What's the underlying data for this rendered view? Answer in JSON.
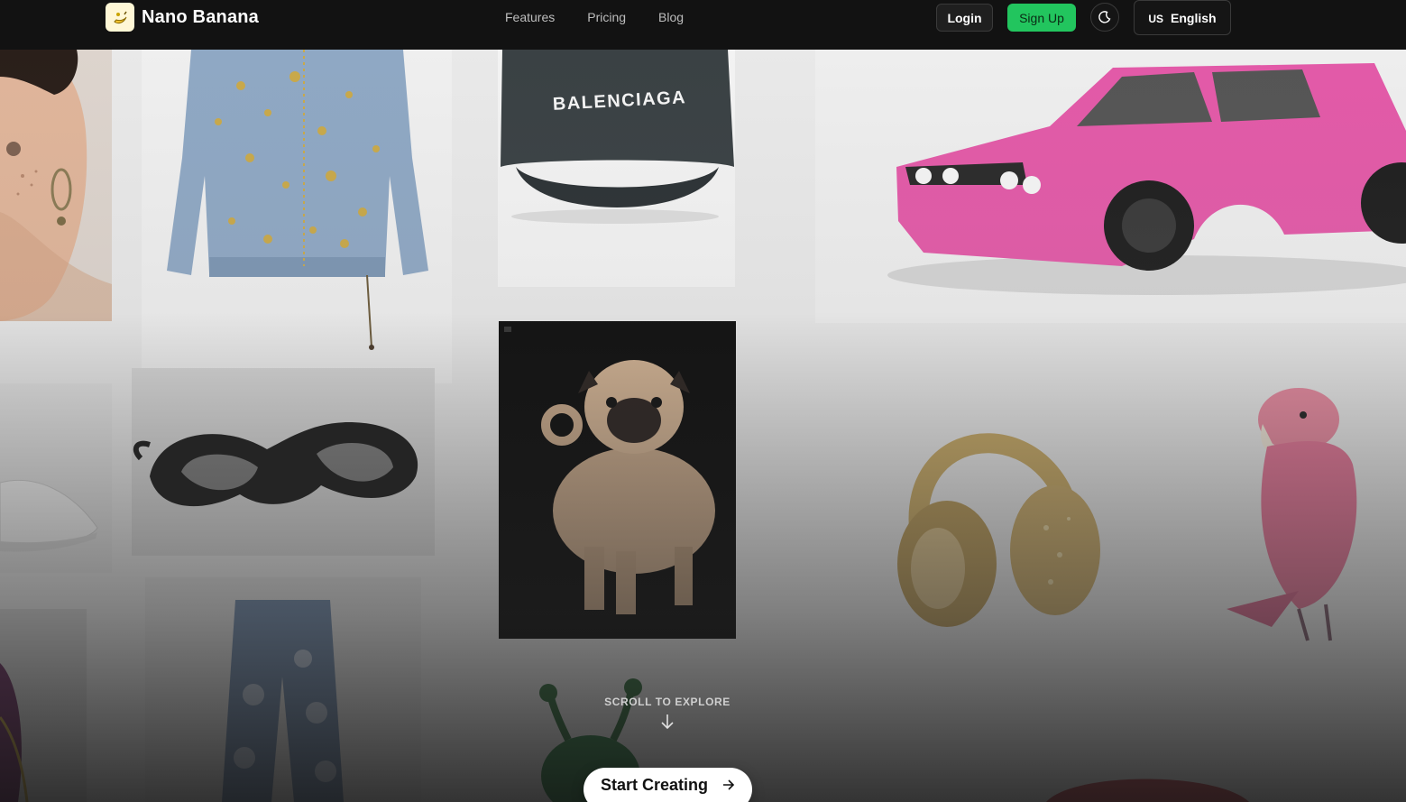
{
  "brand": {
    "name": "Nano Banana",
    "logo_icon": "banana-icon"
  },
  "nav": {
    "links": [
      "Features",
      "Pricing",
      "Blog"
    ]
  },
  "auth": {
    "login_label": "Login",
    "signup_label": "Sign Up"
  },
  "theme_toggle": {
    "icon": "moon-icon"
  },
  "language": {
    "flag": "US",
    "label": "English"
  },
  "gallery": {
    "items": [
      {
        "name": "freckled-woman-portrait"
      },
      {
        "name": "embellished-denim-jacket"
      },
      {
        "name": "balenciaga-cap",
        "text": "BALENCIAGA"
      },
      {
        "name": "pink-bmw-car"
      },
      {
        "name": "white-sneaker"
      },
      {
        "name": "black-sculpted-sunglasses"
      },
      {
        "name": "pug-dog"
      },
      {
        "name": "gold-jeweled-headphones"
      },
      {
        "name": "pink-parrot"
      },
      {
        "name": "purple-bag"
      },
      {
        "name": "flower-jeans"
      },
      {
        "name": "green-alien-plush"
      },
      {
        "name": "red-object"
      }
    ]
  },
  "scroll_hint": {
    "text": "SCROLL TO EXPLORE",
    "icon": "arrow-down-icon"
  },
  "cta": {
    "label": "Start Creating",
    "icon": "arrow-right-icon"
  },
  "colors": {
    "nav_bg": "#121212",
    "signup_green": "#22c55e",
    "cta_bg": "#ffffff"
  }
}
